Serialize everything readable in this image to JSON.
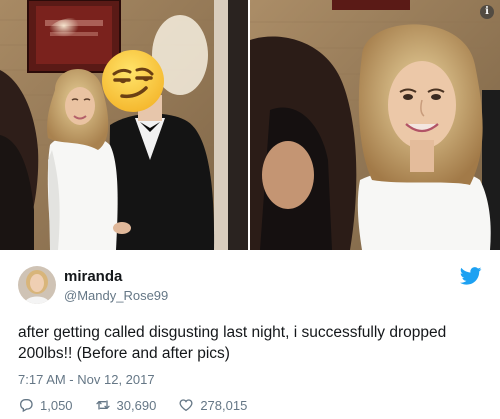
{
  "tweet": {
    "display_name": "miranda",
    "handle": "@Mandy_Rose99",
    "text": "after getting called disgusting last night, i successfully dropped 200lbs!! (Before and after pics)",
    "timestamp": "7:17 AM - Nov 12, 2017",
    "replies": "1,050",
    "retweets": "30,690",
    "likes": "278,015"
  },
  "media": {
    "left_photo": "before photo with face emoji",
    "right_photo": "after photo cropped",
    "overlay_emoji": "smirking-face-emoji"
  },
  "icons": {
    "reply": "reply-icon",
    "retweet": "retweet-icon",
    "like": "heart-icon",
    "logo": "twitter-bird-icon",
    "info": "info-icon"
  },
  "colors": {
    "twitter_blue": "#1da1f2",
    "meta_gray": "#657786",
    "text": "#14171a"
  }
}
